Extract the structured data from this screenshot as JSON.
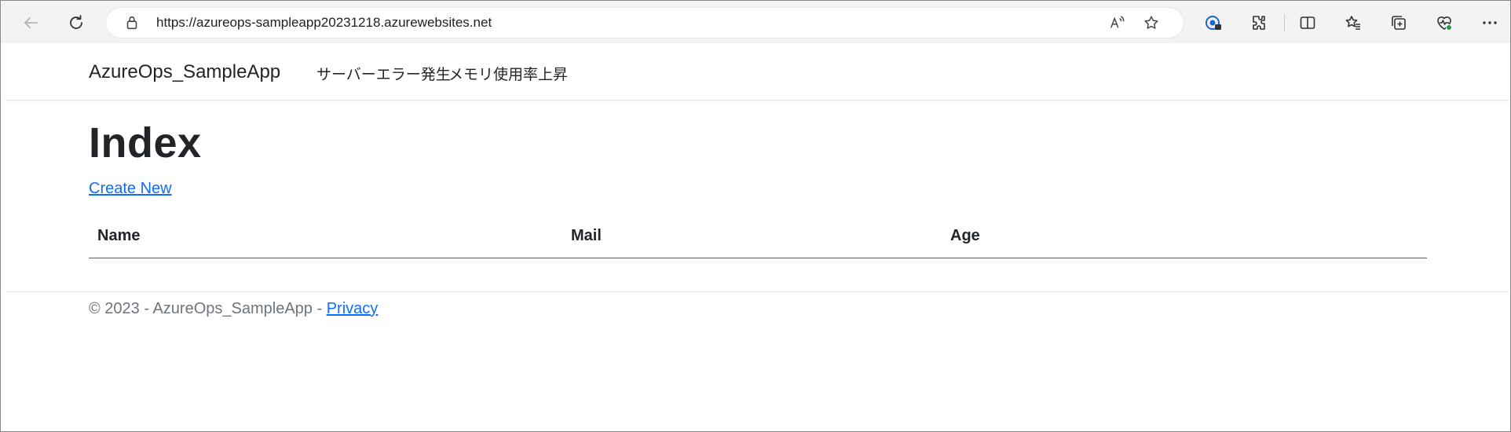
{
  "browser": {
    "url": "https://azureops-sampleapp20231218.azurewebsites.net",
    "icons": [
      "back-icon",
      "refresh-icon",
      "lock-icon",
      "read-aloud-icon",
      "favorite-star-icon",
      "password-manager-icon",
      "extensions-icon",
      "split-screen-icon",
      "favorites-icon",
      "collections-icon",
      "browser-essentials-icon",
      "more-icon"
    ]
  },
  "navbar": {
    "brand": "AzureOps_SampleApp",
    "links": [
      "サーバーエラー発生",
      "メモリ使用率上昇"
    ]
  },
  "main": {
    "title": "Index",
    "create_link": "Create New",
    "table": {
      "headers": [
        "Name",
        "Mail",
        "Age"
      ],
      "rows": []
    }
  },
  "footer": {
    "copyright": "© 2023 - AzureOps_SampleApp - ",
    "privacy_link": "Privacy"
  },
  "colors": {
    "link": "#0d6efd",
    "text": "#212529",
    "muted": "#6c757d",
    "toolbar": "#f3f3f3"
  }
}
